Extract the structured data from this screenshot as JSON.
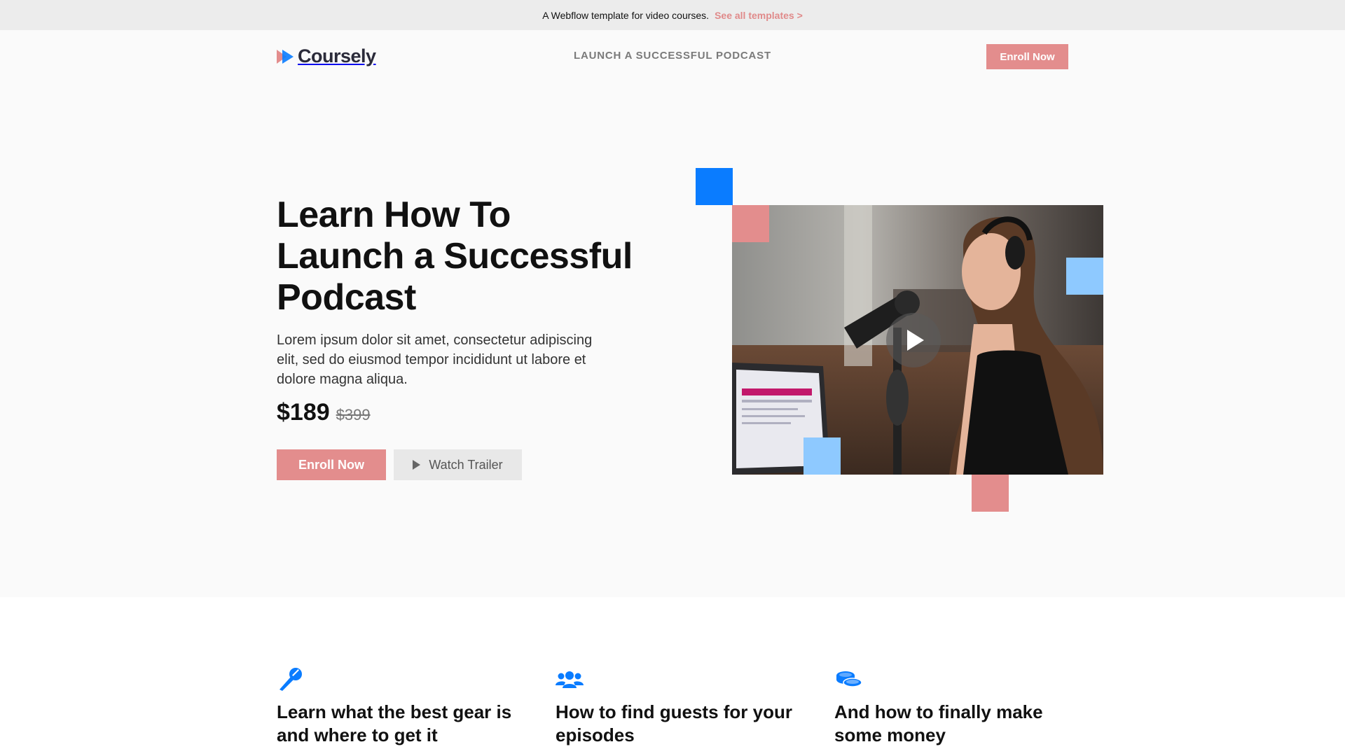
{
  "banner": {
    "message": "A Webflow template for video courses.",
    "link": "See all templates >"
  },
  "nav": {
    "logo_text": "Coursely",
    "center_link": "LAUNCH A SUCCESSFUL PODCAST",
    "enroll_label": "Enroll Now"
  },
  "hero": {
    "title_line1": "Learn How To",
    "title_line2": "Launch a Successful",
    "title_line3": "Podcast",
    "description": "Lorem ipsum dolor sit amet, consectetur adipiscing elit, sed do eiusmod tempor incididunt ut labore et dolore magna aliqua.",
    "price": "$189",
    "old_price": "$399",
    "enroll_label": "Enroll Now",
    "trailer_label": "Watch Trailer"
  },
  "features": [
    {
      "icon": "microphone-icon",
      "title": "Learn what the best gear is and where to get it"
    },
    {
      "icon": "users-icon",
      "title": "How to find guests for your episodes"
    },
    {
      "icon": "coins-icon",
      "title": "And how to finally make some money"
    }
  ],
  "colors": {
    "accent_pink": "#e38d8d",
    "accent_blue": "#0a7cff",
    "light_blue": "#8ec9ff",
    "banner_bg": "#ececec"
  }
}
